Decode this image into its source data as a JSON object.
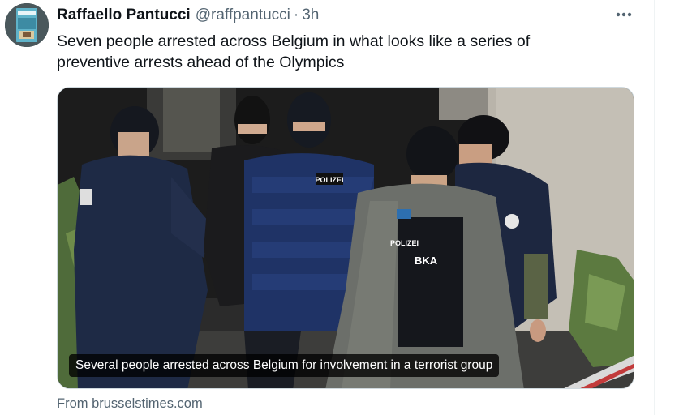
{
  "author": {
    "display_name": "Raffaello Pantucci",
    "handle": "@raffpantucci",
    "separator": "·",
    "time": "3h"
  },
  "tweet": {
    "text_line1": "Seven people arrested across Belgium in what looks like a series of",
    "text_line2": "preventive arrests ahead of the Olympics"
  },
  "media": {
    "caption": "Several people arrested across Belgium for involvement in a terrorist group",
    "badges": {
      "polizei_1": "POLIZEI",
      "polizei_2": "POLIZEI",
      "bka": "BKA"
    }
  },
  "link_card": {
    "source": "From brusselstimes.com"
  },
  "icons": {
    "more": "more-horizontal-icon",
    "avatar": "avatar-book-cover"
  },
  "colors": {
    "text_primary": "#0f1419",
    "text_secondary": "#536471",
    "border": "#cfd9de"
  }
}
